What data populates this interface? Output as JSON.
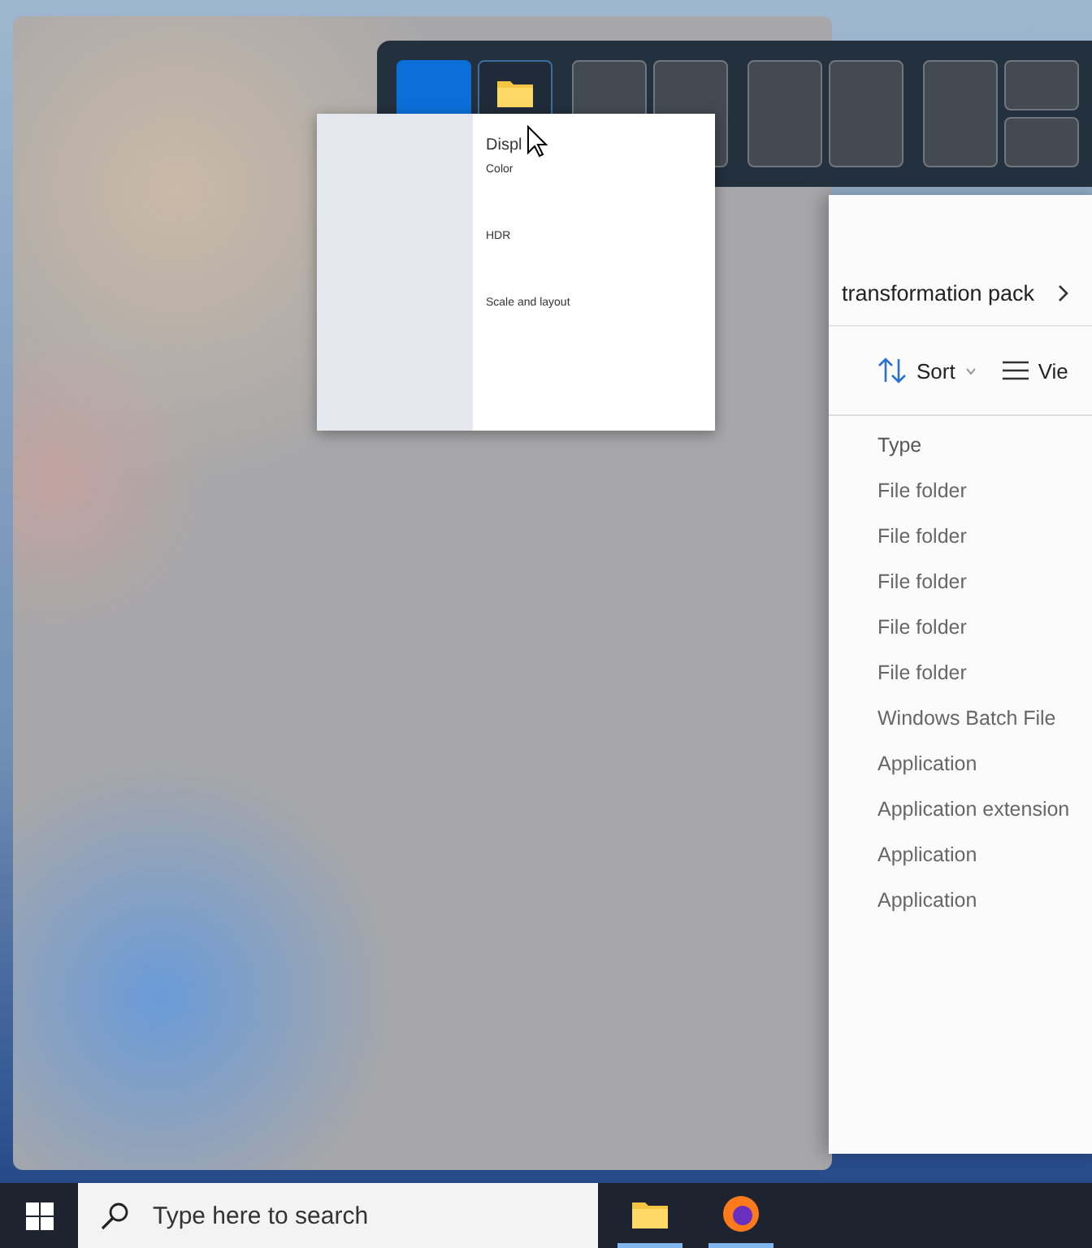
{
  "snap_layouts": [
    {
      "columns": [
        [
          {
            "filled": true,
            "hovered": false
          }
        ],
        [
          {
            "filled": false,
            "hovered": true
          }
        ]
      ]
    },
    {
      "columns": [
        [
          {
            "filled": false,
            "hovered": false
          }
        ],
        [
          {
            "filled": false,
            "hovered": false
          }
        ]
      ]
    },
    {
      "columns": [
        [
          {
            "filled": false,
            "hovered": false
          }
        ],
        [
          {
            "filled": false,
            "hovered": false
          }
        ]
      ]
    },
    {
      "columns": [
        [
          {
            "filled": false,
            "hovered": false
          }
        ],
        [
          {
            "filled": false,
            "hovered": false
          },
          {
            "filled": false,
            "hovered": false
          }
        ]
      ]
    }
  ],
  "preview_window": {
    "title": "Displ",
    "sections": [
      "Color",
      "HDR",
      "Scale and layout"
    ]
  },
  "explorer": {
    "breadcrumb": "transformation pack",
    "toolbar": [
      {
        "kind": "sort",
        "label": "Sort"
      },
      {
        "kind": "view",
        "label": "Vie"
      }
    ],
    "columns": [
      "Type"
    ],
    "rows": [
      "File folder",
      "File folder",
      "File folder",
      "File folder",
      "File folder",
      "Windows Batch File",
      "Application",
      "Application extension",
      "Application",
      "Application"
    ]
  },
  "taskbar": {
    "search_placeholder": "Type here to search",
    "apps": [
      {
        "kind": "explorer",
        "running": true
      },
      {
        "kind": "firefox",
        "running": true
      }
    ]
  }
}
